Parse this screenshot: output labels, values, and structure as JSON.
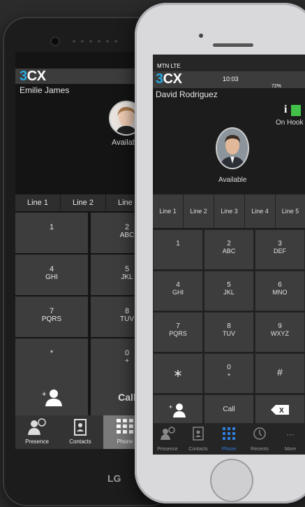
{
  "back_phone": {
    "name": "Emilie James",
    "status": "Available",
    "lines": [
      "Line 1",
      "Line 2",
      "Line 3"
    ],
    "keys": [
      {
        "digit": "1",
        "letters": ""
      },
      {
        "digit": "2",
        "letters": "ABC"
      },
      {
        "digit": "4",
        "letters": "GHI"
      },
      {
        "digit": "5",
        "letters": "JKL"
      },
      {
        "digit": "7",
        "letters": "PQRS"
      },
      {
        "digit": "8",
        "letters": "TUV"
      },
      {
        "digit": "*",
        "letters": ""
      },
      {
        "digit": "0",
        "letters": "+"
      }
    ],
    "call_label": "Call",
    "tabs": [
      "Presence",
      "Contacts",
      "Phone"
    ],
    "brand": "LG"
  },
  "front_phone": {
    "carrier": "MTN  LTE",
    "time": "10:03",
    "battery": "72%",
    "name": "David Rodriguez",
    "info_label": "i",
    "hook_status": "On Hook",
    "status": "Available",
    "lines": [
      "Line 1",
      "Line 2",
      "Line 3",
      "Line 4",
      "Line 5"
    ],
    "keys": [
      {
        "digit": "1",
        "letters": ""
      },
      {
        "digit": "2",
        "letters": "ABC"
      },
      {
        "digit": "3",
        "letters": "DEF"
      },
      {
        "digit": "4",
        "letters": "GHI"
      },
      {
        "digit": "5",
        "letters": "JKL"
      },
      {
        "digit": "6",
        "letters": "MNO"
      },
      {
        "digit": "7",
        "letters": "PQRS"
      },
      {
        "digit": "8",
        "letters": "TUV"
      },
      {
        "digit": "9",
        "letters": "WXYZ"
      },
      {
        "digit": "∗",
        "letters": ""
      },
      {
        "digit": "0",
        "letters": "+"
      },
      {
        "digit": "#",
        "letters": ""
      }
    ],
    "call_label": "Call",
    "backspace_label": "X",
    "tabs": [
      "Presence",
      "Contacts",
      "Phone",
      "Recents",
      "More"
    ],
    "more_icon": "···"
  },
  "logo": {
    "three": "3",
    "cx": "CX"
  },
  "colors": {
    "accent": "#29a8e0",
    "status_green": "#43c24a",
    "active_tab": "#2f7fe0"
  }
}
